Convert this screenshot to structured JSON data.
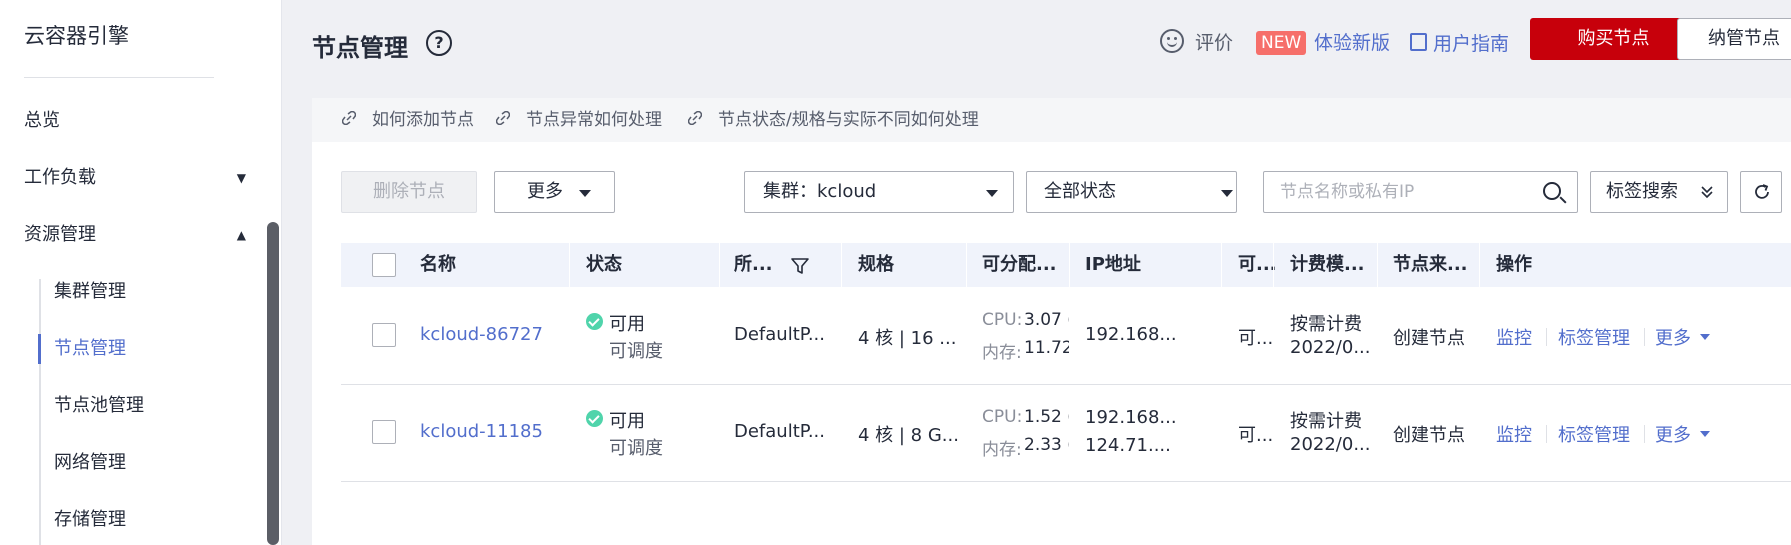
{
  "sidebar": {
    "app_title": "云容器引擎",
    "items": [
      {
        "label": "总览"
      },
      {
        "label": "工作负载"
      },
      {
        "label": "资源管理"
      }
    ],
    "sub_items": [
      {
        "label": "集群管理"
      },
      {
        "label": "节点管理"
      },
      {
        "label": "节点池管理"
      },
      {
        "label": "网络管理"
      },
      {
        "label": "存储管理"
      }
    ]
  },
  "header": {
    "title": "节点管理",
    "help": "?",
    "feedback": "评价",
    "new_badge": "NEW",
    "try_new": "体验新版",
    "user_guide": "用户指南",
    "buy_node": "购买节点",
    "manage_node": "纳管节点"
  },
  "faq_links": [
    "如何添加节点",
    "节点异常如何处理",
    "节点状态/规格与实际不同如何处理"
  ],
  "toolbar": {
    "delete_node": "删除节点",
    "more": "更多",
    "cluster_select": "集群：kcloud",
    "status_select": "全部状态",
    "search_placeholder": "节点名称或私有IP",
    "tag_search": "标签搜索"
  },
  "table": {
    "headers": [
      "名称",
      "状态",
      "所...",
      "规格",
      "可分配...",
      "IP地址",
      "可...",
      "计费模...",
      "节点来...",
      "操作"
    ],
    "rows": [
      {
        "name": "kcloud-86727",
        "status": "可用",
        "status_sub": "可调度",
        "pool": "DefaultP...",
        "spec": "4 核 | 16 ...",
        "cpu_label": "CPU:",
        "cpu_value": "3.07 (",
        "mem_label": "内存:",
        "mem_value": "11.72",
        "ip1": "192.168...",
        "ip2": "",
        "az": "可...",
        "billing": "按需计费",
        "billing_date": "2022/0...",
        "source": "创建节点",
        "actions": [
          "监控",
          "标签管理",
          "更多"
        ]
      },
      {
        "name": "kcloud-11185",
        "status": "可用",
        "status_sub": "可调度",
        "pool": "DefaultP...",
        "spec": "4 核 | 8 G...",
        "cpu_label": "CPU:",
        "cpu_value": "1.52 (",
        "mem_label": "内存:",
        "mem_value": "2.33 (",
        "ip1": "192.168...",
        "ip2": "124.71....",
        "az": "可...",
        "billing": "按需计费",
        "billing_date": "2022/0...",
        "source": "创建节点",
        "actions": [
          "监控",
          "标签管理",
          "更多"
        ]
      }
    ]
  },
  "colors": {
    "brand_red": "#c7000b",
    "link_blue": "#526ecc",
    "status_green": "#50d4ab",
    "new_badge": "#f66f6a"
  }
}
